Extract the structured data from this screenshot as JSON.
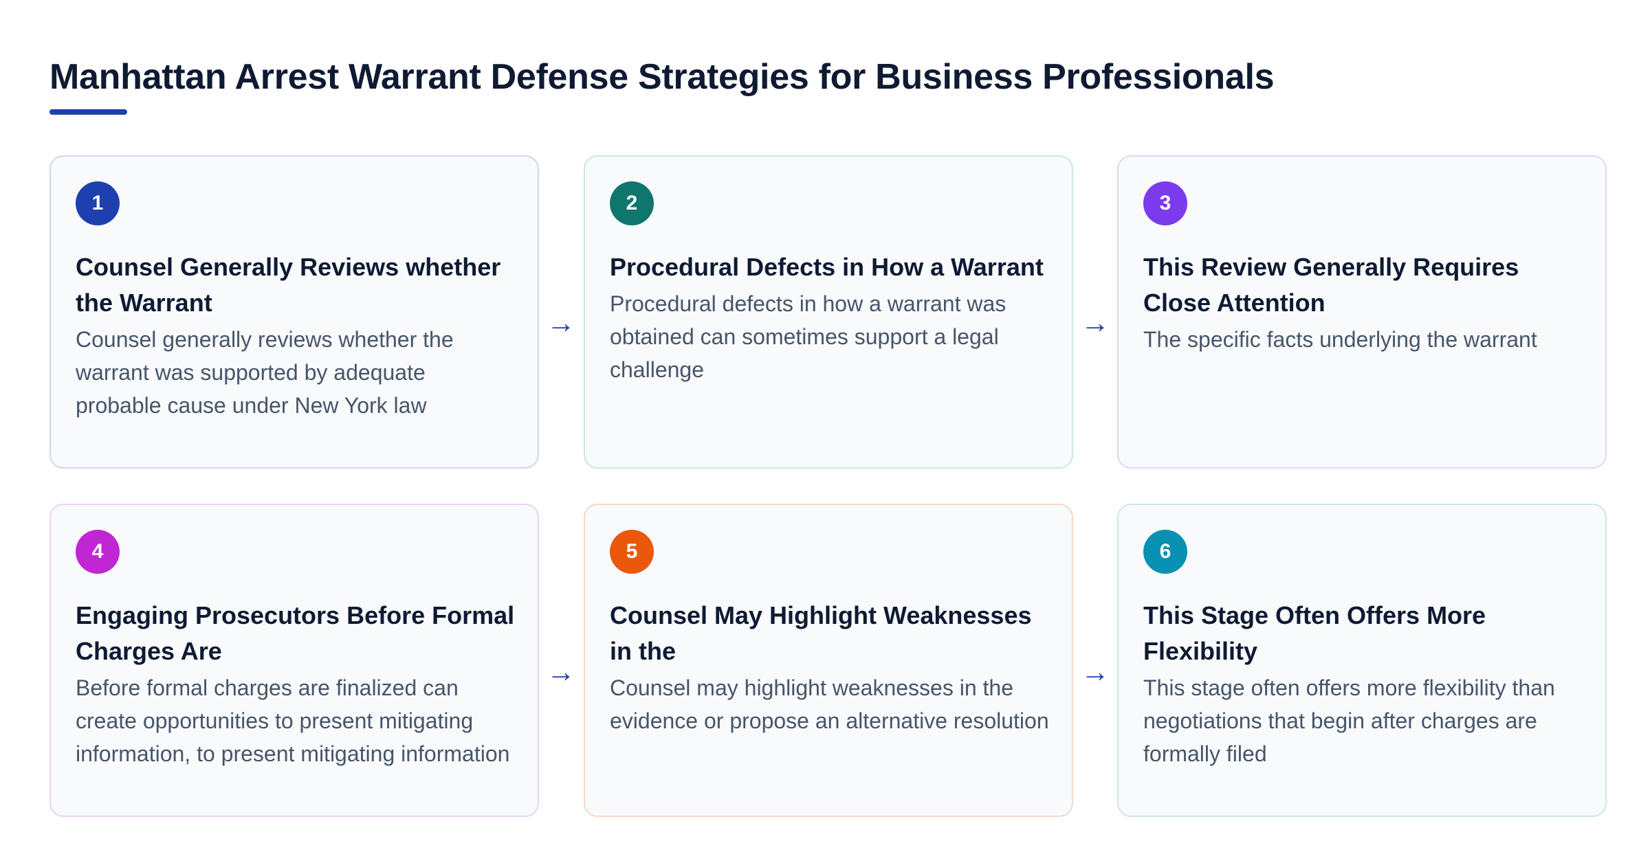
{
  "title": "Manhattan Arrest Warrant Defense Strategies for Business Professionals",
  "arrow_glyph": "→",
  "steps": [
    {
      "number": "1",
      "color": "#1e40af",
      "heading": "Counsel Generally Reviews whether the Warrant",
      "description": "Counsel generally reviews whether the warrant was supported by adequate probable cause under New York law"
    },
    {
      "number": "2",
      "color": "#0f766e",
      "heading": "Procedural Defects in How a Warrant",
      "description": "Procedural defects in how a warrant was obtained can sometimes support a legal challenge"
    },
    {
      "number": "3",
      "color": "#7c3aed",
      "heading": "This Review Generally Requires Close Attention",
      "description": "The specific facts underlying the warrant"
    },
    {
      "number": "4",
      "color": "#c026d3",
      "heading": "Engaging Prosecutors Before Formal Charges Are",
      "description": "Before formal charges are finalized can create opportunities to present mitigating information, to present mitigating information"
    },
    {
      "number": "5",
      "color": "#ea580c",
      "heading": "Counsel May Highlight Weaknesses in the",
      "description": "Counsel may highlight weaknesses in the evidence or propose an alternative resolution"
    },
    {
      "number": "6",
      "color": "#0891b2",
      "heading": "This Stage Often Offers More Flexibility",
      "description": "This stage often offers more flexibility than negotiations that begin after charges are formally filed"
    }
  ]
}
